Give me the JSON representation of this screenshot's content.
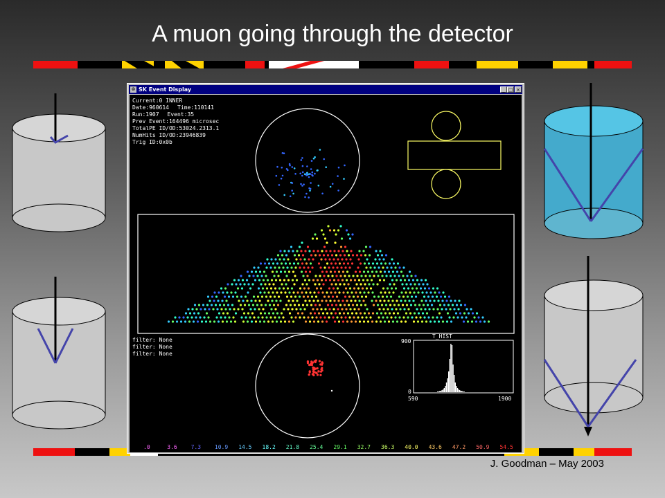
{
  "slide": {
    "title": "A muon going through the detector",
    "footer": "J. Goodman – May 2003"
  },
  "window": {
    "title": "SK Event Display",
    "buttons": [
      "_",
      "□",
      "×"
    ]
  },
  "event_info": {
    "current_label": "Current:",
    "current_value": "0  INNER",
    "date_label": "Date:",
    "date_value": "960614",
    "time_label": "Time:",
    "time_value": "110141",
    "run_label": "Run:",
    "run_value": "1907",
    "event_label": "Event:",
    "event_value": "35",
    "prev_label": "Prev Event:",
    "prev_value": "164496 microsec",
    "totalpe_label": "TotalPE ID/OD:",
    "totalpe_id": "53024.2",
    "totalpe_od": "313.1",
    "numhits_label": "NumHits ID/OD:",
    "numhits_id": "2394",
    "numhits_od": "6839",
    "trig_label": "Trig ID:",
    "trig_value": "0x0b"
  },
  "filters": [
    "filter: None",
    "filter: None",
    "filter: None"
  ],
  "histogram": {
    "title": "T_HIST",
    "y_max": "900",
    "y_min": "0",
    "x_min": "590",
    "x_max": "1900"
  },
  "color_scale": [
    {
      "value": ".0",
      "color": "#ff66ff"
    },
    {
      "value": "3.6",
      "color": "#ff66ff"
    },
    {
      "value": "7.3",
      "color": "#6666ff"
    },
    {
      "value": "10.9",
      "color": "#6699ff"
    },
    {
      "value": "14.5",
      "color": "#66ccff"
    },
    {
      "value": "18.2",
      "color": "#66ffff"
    },
    {
      "value": "21.8",
      "color": "#66ffcc"
    },
    {
      "value": "25.4",
      "color": "#66ff99"
    },
    {
      "value": "29.1",
      "color": "#66ff66"
    },
    {
      "value": "32.7",
      "color": "#99ff66"
    },
    {
      "value": "36.3",
      "color": "#ccff66"
    },
    {
      "value": "40.0",
      "color": "#ffff66"
    },
    {
      "value": "43.6",
      "color": "#ffcc66"
    },
    {
      "value": "47.2",
      "color": "#ff9966"
    },
    {
      "value": "50.9",
      "color": "#ff6666"
    },
    {
      "value": "54.5",
      "color": "#ff3333"
    }
  ],
  "colors": {
    "stripe_red": "#ee1111",
    "stripe_yellow": "#ffd200",
    "stripe_black": "#000000",
    "stripe_white": "#ffffff",
    "cylinder_gray": "#c8c8c8",
    "cylinder_blue": "#44bbdd",
    "cherenkov_line": "#4444aa",
    "display_outline": "#ffffff",
    "od_outline": "#ffff66"
  }
}
